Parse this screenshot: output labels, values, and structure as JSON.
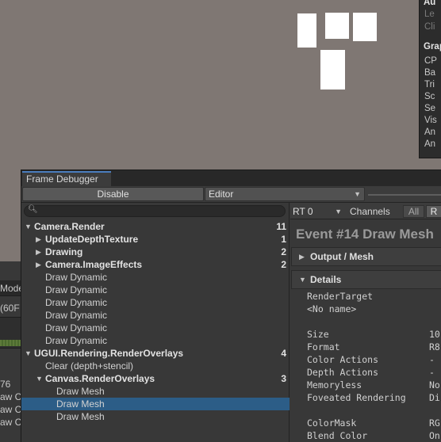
{
  "stats_panel": {
    "rows": [
      {
        "text": "Au",
        "kind": "hdr"
      },
      {
        "text": "Le",
        "kind": "dim"
      },
      {
        "text": "Cli",
        "kind": "dim"
      },
      {
        "text": "Grap",
        "kind": "hdr"
      },
      {
        "text": "CP",
        "kind": "row"
      },
      {
        "text": "Ba",
        "kind": "row"
      },
      {
        "text": "Tri",
        "kind": "row"
      },
      {
        "text": "Sc",
        "kind": "row"
      },
      {
        "text": "Se",
        "kind": "row"
      },
      {
        "text": "Vis",
        "kind": "row"
      },
      {
        "text": "An",
        "kind": "row"
      },
      {
        "text": "An",
        "kind": "row"
      }
    ]
  },
  "background_window": {
    "mode_label": "Mode",
    "fps_label": "(60F",
    "stat_number": "76",
    "stat_rows": [
      "aw Ca",
      "aw Ca",
      "aw Ca"
    ]
  },
  "frame_debugger": {
    "tab_title": "Frame Debugger",
    "disable_label": "Disable",
    "target_dropdown": "Editor",
    "search_placeholder": "",
    "tree": [
      {
        "label": "Camera.Render",
        "bold": true,
        "expanded": true,
        "has_children": true,
        "indent": 0,
        "count": "11",
        "selected": false
      },
      {
        "label": "UpdateDepthTexture",
        "bold": true,
        "expanded": false,
        "has_children": true,
        "indent": 1,
        "count": "1",
        "selected": false
      },
      {
        "label": "Drawing",
        "bold": true,
        "expanded": false,
        "has_children": true,
        "indent": 1,
        "count": "2",
        "selected": false
      },
      {
        "label": "Camera.ImageEffects",
        "bold": true,
        "expanded": false,
        "has_children": true,
        "indent": 1,
        "count": "2",
        "selected": false
      },
      {
        "label": "Draw Dynamic",
        "bold": false,
        "has_children": false,
        "indent": 1,
        "count": "",
        "selected": false
      },
      {
        "label": "Draw Dynamic",
        "bold": false,
        "has_children": false,
        "indent": 1,
        "count": "",
        "selected": false
      },
      {
        "label": "Draw Dynamic",
        "bold": false,
        "has_children": false,
        "indent": 1,
        "count": "",
        "selected": false
      },
      {
        "label": "Draw Dynamic",
        "bold": false,
        "has_children": false,
        "indent": 1,
        "count": "",
        "selected": false
      },
      {
        "label": "Draw Dynamic",
        "bold": false,
        "has_children": false,
        "indent": 1,
        "count": "",
        "selected": false
      },
      {
        "label": "Draw Dynamic",
        "bold": false,
        "has_children": false,
        "indent": 1,
        "count": "",
        "selected": false
      },
      {
        "label": "UGUI.Rendering.RenderOverlays",
        "bold": true,
        "expanded": true,
        "has_children": true,
        "indent": 0,
        "count": "4",
        "selected": false
      },
      {
        "label": "Clear (depth+stencil)",
        "bold": false,
        "has_children": false,
        "indent": 1,
        "count": "",
        "selected": false
      },
      {
        "label": "Canvas.RenderOverlays",
        "bold": true,
        "expanded": true,
        "has_children": true,
        "indent": 1,
        "count": "3",
        "selected": false
      },
      {
        "label": "Draw Mesh",
        "bold": false,
        "has_children": false,
        "indent": 2,
        "count": "",
        "selected": false
      },
      {
        "label": "Draw Mesh",
        "bold": false,
        "has_children": false,
        "indent": 2,
        "count": "",
        "selected": true
      },
      {
        "label": "Draw Mesh",
        "bold": false,
        "has_children": false,
        "indent": 2,
        "count": "",
        "selected": false
      }
    ],
    "rt_dropdown": "RT 0",
    "channels_label": "Channels",
    "channel_all": "All",
    "channel_r": "R",
    "event_title": "Event #14 Draw Mesh",
    "output_mesh_label": "Output / Mesh",
    "details_label": "Details",
    "details": [
      {
        "name": "RenderTarget",
        "value": ""
      },
      {
        "name": "<No name>",
        "value": ""
      },
      {
        "name": "Size",
        "value": "10"
      },
      {
        "name": "Format",
        "value": "R8"
      },
      {
        "name": "Color Actions",
        "value": "-"
      },
      {
        "name": "Depth Actions",
        "value": "-"
      },
      {
        "name": "Memoryless",
        "value": "No"
      },
      {
        "name": "Foveated Rendering",
        "value": "Di"
      },
      {
        "name": "ColorMask",
        "value": "RG"
      },
      {
        "name": "Blend Color",
        "value": "On"
      }
    ]
  },
  "colors": {
    "scene_bg": "#7f7773",
    "panel_bg": "#383838",
    "selection": "#2c5d87",
    "tab_accent": "#4a7dbd"
  }
}
